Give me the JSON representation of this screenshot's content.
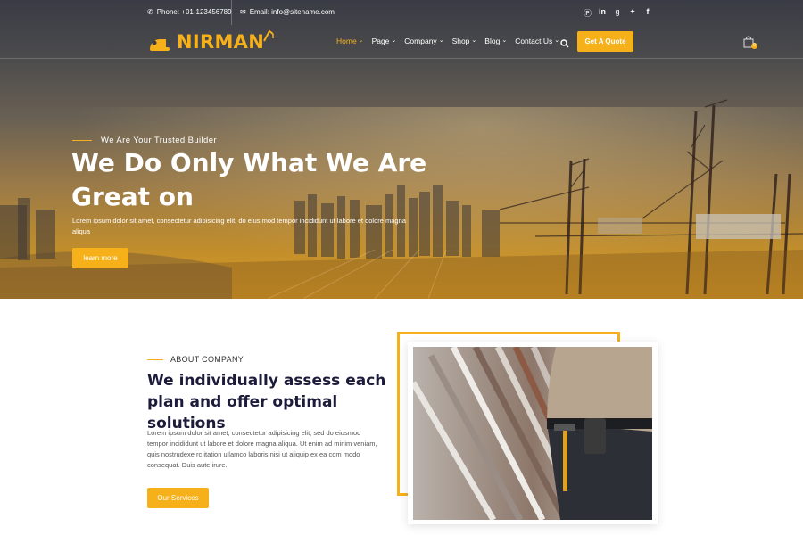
{
  "topbar": {
    "phone": "Phone: +01-123456789",
    "email": "Email: info@sitename.com",
    "social": [
      "pinterest-icon",
      "linkedin-icon",
      "google-plus-icon",
      "twitter-icon",
      "facebook-icon"
    ]
  },
  "brand": {
    "name": "NIRMAN",
    "color": "#f6b01a"
  },
  "nav": {
    "items": [
      {
        "label": "Home",
        "active": true
      },
      {
        "label": "Page"
      },
      {
        "label": "Company"
      },
      {
        "label": "Shop"
      },
      {
        "label": "Blog"
      },
      {
        "label": "Contact Us"
      }
    ],
    "quote_label": "Get A Quote",
    "cart_count": "0"
  },
  "hero": {
    "tagline": "We Are Your Trusted Builder",
    "title": "We Do Only What We Are Great on",
    "description": "Lorem ipsum dolor sit amet, consectetur adipisicing elit, do eius mod tempor incididunt ut labore et dolore magna aliqua",
    "button": "learn more"
  },
  "about": {
    "label": "ABOUT COMPANY",
    "title": "We individually assess each plan and offer optimal solutions",
    "text": "Lorem ipsum dolor sit amet, consectetur adipisicing elit, sed do eiusmod tempor incididunt ut labore et dolore magna aliqua. Ut enim ad minim veniam, quis nostrudexe rc itation ullamco laboris nisi ut aliquip ex ea com modo consequat. Duis aute irure.",
    "button": "Our Services"
  }
}
